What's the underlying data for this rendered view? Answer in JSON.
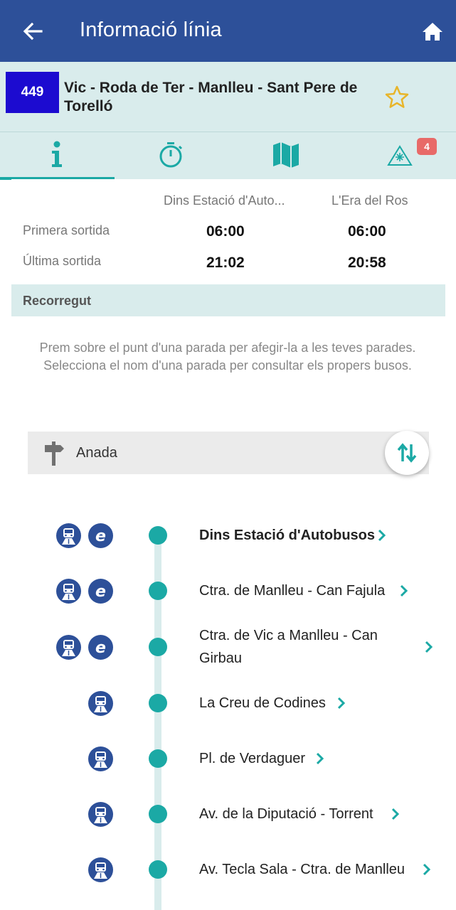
{
  "appbar": {
    "title": "Informació línia",
    "back_icon": "arrow-left-icon",
    "home_icon": "home-icon"
  },
  "line": {
    "number": "449",
    "name": "Vic - Roda de Ter - Manlleu - Sant Pere de Torelló",
    "badge_color": "#1c0bd0",
    "favorite_icon": "star-outline-icon"
  },
  "tabs": [
    {
      "id": "info",
      "icon": "info-icon",
      "active": true
    },
    {
      "id": "timetable",
      "icon": "stopwatch-icon"
    },
    {
      "id": "map",
      "icon": "map-icon"
    },
    {
      "id": "alerts",
      "icon": "alert-icon",
      "badge": "4"
    }
  ],
  "schedule": {
    "columns": [
      "Dins Estació d'Auto...",
      "L'Era del Ros"
    ],
    "rows": [
      {
        "label": "Primera sortida",
        "values": [
          "06:00",
          "06:00"
        ]
      },
      {
        "label": "Última sortida",
        "values": [
          "21:02",
          "20:58"
        ]
      }
    ]
  },
  "route": {
    "section_title": "Recorregut",
    "hint": "Prem sobre el punt d'una parada per afegir-la a les teves parades. Selecciona el nom d'una parada per consultar els propers busos.",
    "direction": "Anada"
  },
  "stops": [
    {
      "name": "Dins Estació d'Autobusos",
      "bold": true,
      "icons": [
        "bus-stop-icon",
        "e-icon"
      ]
    },
    {
      "name": "Ctra. de Manlleu - Can Fajula",
      "icons": [
        "bus-stop-icon",
        "e-icon"
      ]
    },
    {
      "name": "Ctra. de Vic a Manlleu - Can Girbau",
      "icons": [
        "bus-stop-icon",
        "e-icon"
      ]
    },
    {
      "name": "La Creu de Codines",
      "icons": [
        "bus-stop-icon"
      ]
    },
    {
      "name": "Pl. de Verdaguer",
      "icons": [
        "bus-stop-icon"
      ]
    },
    {
      "name": "Av. de la Diputació - Torrent",
      "icons": [
        "bus-stop-icon"
      ]
    },
    {
      "name": "Av. Tecla Sala - Ctra. de Manlleu",
      "icons": [
        "bus-stop-icon"
      ]
    }
  ],
  "colors": {
    "primary": "#2d5099",
    "accent": "#1ba9a5",
    "light": "#d9ecec",
    "star": "#e8b52a",
    "notif": "#e86a68"
  }
}
